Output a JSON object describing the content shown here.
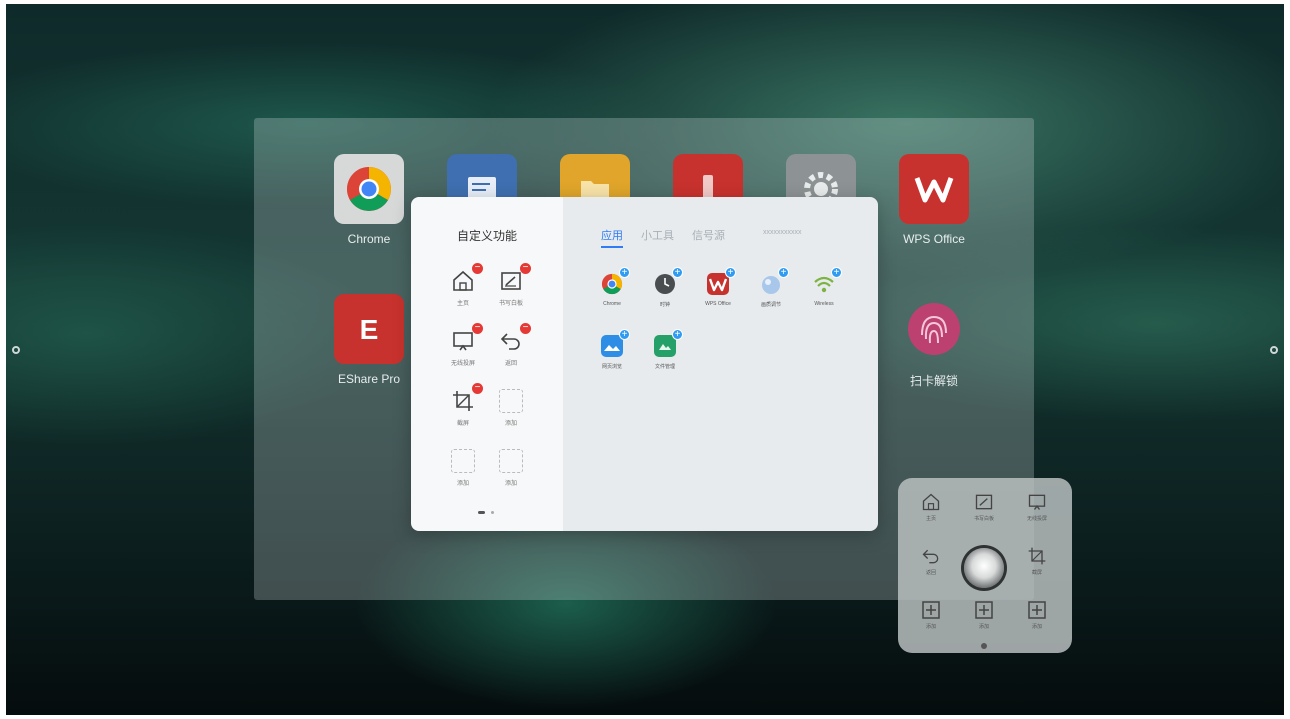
{
  "launcher": {
    "apps": [
      {
        "name": "chrome",
        "label": "Chrome"
      },
      {
        "name": "notes",
        "label": ""
      },
      {
        "name": "files",
        "label": ""
      },
      {
        "name": "toolbox",
        "label": ""
      },
      {
        "name": "settings",
        "label": ""
      },
      {
        "name": "wps",
        "label": "WPS Office"
      },
      {
        "name": "eshare",
        "label": "EShare Pro"
      },
      {
        "name": "fingerprint",
        "label": "扫卡解锁"
      }
    ]
  },
  "dialog": {
    "title": "自定义功能",
    "tabs": {
      "apps": "应用",
      "tools": "小工具",
      "signal": "信号源",
      "extra": "xxxxxxxxxxx"
    },
    "page_dots": 2,
    "slots": [
      {
        "label": "主页",
        "icon": "home-icon",
        "removable": true
      },
      {
        "label": "书写白板",
        "icon": "whiteboard-icon",
        "removable": true
      },
      {
        "label": "无线投屏",
        "icon": "screen-cast-icon",
        "removable": true
      },
      {
        "label": "返回",
        "icon": "back-icon",
        "removable": true
      },
      {
        "label": "截屏",
        "icon": "screenshot-crop-icon",
        "removable": true
      },
      {
        "label": "添加",
        "icon": "empty-slot",
        "removable": false
      },
      {
        "label": "添加",
        "icon": "empty-slot",
        "removable": false
      },
      {
        "label": "添加",
        "icon": "empty-slot",
        "removable": false
      }
    ],
    "apps": [
      {
        "label": "Chrome",
        "icon": "chrome-icon"
      },
      {
        "label": "时钟",
        "icon": "clock-icon"
      },
      {
        "label": "WPS Office",
        "icon": "wps-icon"
      },
      {
        "label": "画质调节",
        "icon": "bubble-icon"
      },
      {
        "label": "Wireless",
        "icon": "wifi-icon"
      },
      {
        "label": "网页浏览",
        "icon": "photo-icon"
      },
      {
        "label": "文件管理",
        "icon": "folder-green-icon"
      }
    ]
  },
  "floating_menu": {
    "items": [
      {
        "label": "主页",
        "icon": "home-icon"
      },
      {
        "label": "书写白板",
        "icon": "whiteboard-icon"
      },
      {
        "label": "无线投屏",
        "icon": "screen-cast-icon"
      },
      {
        "label": "返回",
        "icon": "back-icon"
      },
      {
        "label": "截屏",
        "icon": "screenshot-crop-icon"
      },
      {
        "label": "添加",
        "icon": "add-box-icon"
      },
      {
        "label": "添加",
        "icon": "add-box-icon"
      },
      {
        "label": "添加",
        "icon": "add-box-icon"
      }
    ]
  },
  "colors": {
    "accent": "#2f7cf6",
    "remove_badge": "#e53935",
    "add_badge": "#2f9bf2"
  }
}
